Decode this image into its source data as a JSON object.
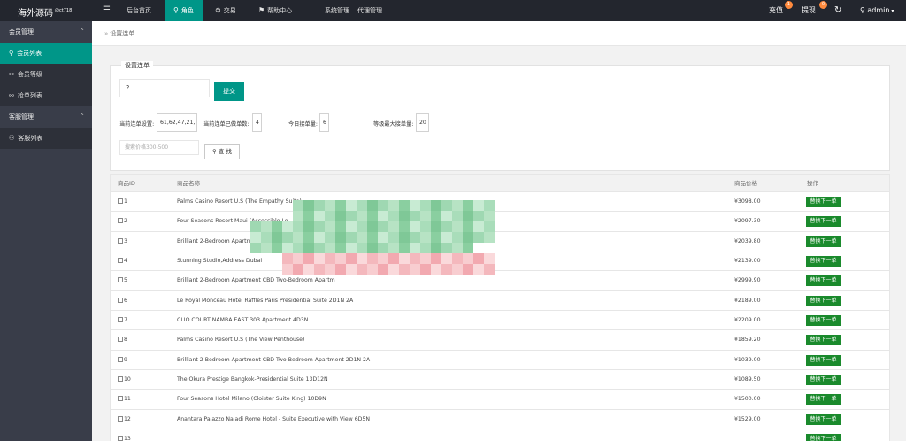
{
  "topbar": {
    "logo": "海外源码",
    "logo_sup": "@ct718",
    "nav": [
      "后台首页",
      "角色",
      "交易",
      "帮助中心",
      "系统管理",
      "代理管理"
    ],
    "recharge": "充值",
    "recharge_badge": "1",
    "withdraw": "提现",
    "withdraw_badge": "0",
    "user": "admin"
  },
  "sidebar": {
    "groups": [
      {
        "label": "会员管理",
        "items": [
          "会员列表",
          "会员等级",
          "抢单列表"
        ]
      },
      {
        "label": "客服管理",
        "items": [
          "客服列表"
        ]
      }
    ]
  },
  "breadcrumb": "设置连单",
  "form": {
    "legend": "设置连单",
    "input_value": "2",
    "submit": "提交",
    "stats": [
      {
        "label": "当前连单设置:",
        "value": "61,62,47,21,1"
      },
      {
        "label": "当前连单已做单数:",
        "value": "4"
      },
      {
        "label": "今日接单量:",
        "value": "6"
      },
      {
        "label": "等级最大接单量:",
        "value": "20"
      }
    ],
    "search_placeholder": "搜索价格300-500",
    "search_button": "查 找"
  },
  "table": {
    "headers": [
      "商品ID",
      "商品名称",
      "商品价格",
      "操作"
    ],
    "action_label": "替换下一单",
    "rows": [
      {
        "id": "1",
        "name": "Palms Casino Resort U.S (The Empathy Suite)",
        "price": "¥3098.00"
      },
      {
        "id": "2",
        "name": "Four Seasons Resort Maui (Accessible Lo",
        "price": "¥2097.30"
      },
      {
        "id": "3",
        "name": "Brilliant 2-Bedroom Apartn",
        "price": "¥2039.80"
      },
      {
        "id": "4",
        "name": "Stunning Studio,Address Dubai",
        "price": "¥2139.00"
      },
      {
        "id": "5",
        "name": "Brilliant 2-Bedroom Apartment CBD Two-Bedroom Apartm",
        "price": "¥2999.90"
      },
      {
        "id": "6",
        "name": "Le Royal Monceau Hotel Raffles Paris Presidential Suite 2D1N 2A",
        "price": "¥2189.00"
      },
      {
        "id": "7",
        "name": "CLIO COURT NAMBA EAST 303 Apartment 4D3N",
        "price": "¥2209.00"
      },
      {
        "id": "8",
        "name": "Palms Casino Resort U.S (The View Penthouse)",
        "price": "¥1859.20"
      },
      {
        "id": "9",
        "name": "Brilliant 2-Bedroom Apartment CBD Two-Bedroom Apartment 2D1N 2A",
        "price": "¥1039.00"
      },
      {
        "id": "10",
        "name": "The Okura Prestige Bangkok-Presidential Suite 13D12N",
        "price": "¥1089.50"
      },
      {
        "id": "11",
        "name": "Four Seasons Hotel Milano (Cloister Suite King) 10D9N",
        "price": "¥1500.00"
      },
      {
        "id": "12",
        "name": "Anantara Palazzo Naiadi Rome Hotel - Suite Executive with View 6D5N",
        "price": "¥1529.00"
      },
      {
        "id": "13",
        "name": "",
        "price": ""
      }
    ]
  },
  "colors": {
    "accent": "#009688",
    "topbar": "#23262e",
    "sidebar": "#393d49",
    "row_button": "#1a8a2c",
    "badge": "#ff8a3d"
  }
}
